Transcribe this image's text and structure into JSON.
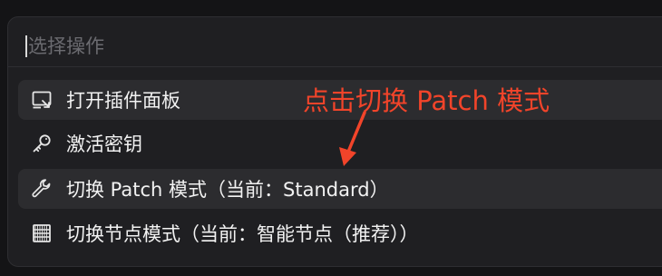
{
  "search": {
    "placeholder": "选择操作",
    "value": ""
  },
  "items": [
    {
      "label": "打开插件面板",
      "icon": "panel-icon",
      "highlighted": true
    },
    {
      "label": "激活密钥",
      "icon": "key-icon",
      "highlighted": false
    },
    {
      "label": "切换 Patch 模式（当前：Standard）",
      "icon": "wrench-icon",
      "highlighted": true
    },
    {
      "label": "切换节点模式（当前：智能节点（推荐））",
      "icon": "server-icon",
      "highlighted": false
    }
  ],
  "annotation": {
    "text": "点击切换 Patch 模式"
  },
  "colors": {
    "background": "#141416",
    "panel": "#1f1f22",
    "highlight": "#2c2c2f",
    "text": "#f2f2f2",
    "placeholder": "#6b6b70",
    "annotation": "#f2442a"
  }
}
